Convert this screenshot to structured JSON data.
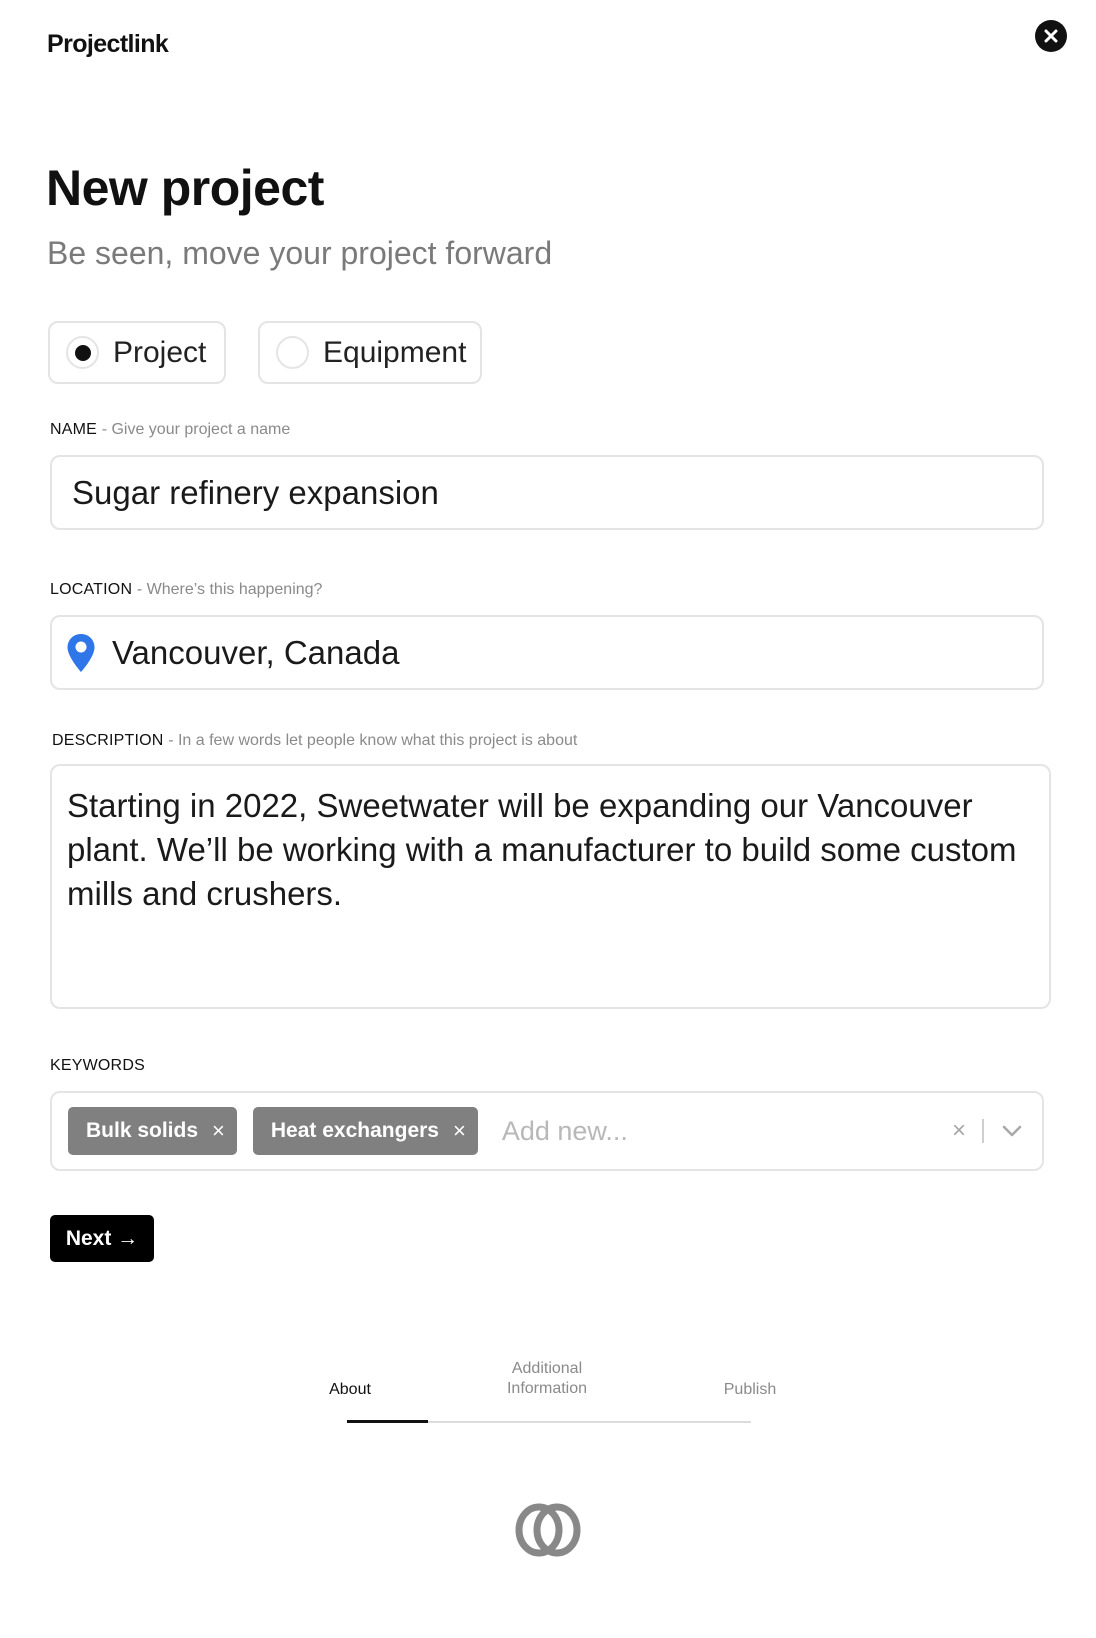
{
  "app": {
    "logo_text": "Projectlink"
  },
  "header": {
    "close_icon": "close-circle-icon"
  },
  "page": {
    "title": "New project",
    "subtitle": "Be seen, move your project forward"
  },
  "type_selector": {
    "options": [
      {
        "label": "Project",
        "selected": true
      },
      {
        "label": "Equipment",
        "selected": false
      }
    ]
  },
  "fields": {
    "name": {
      "label": "NAME",
      "hint": "- Give your project a name",
      "value": "Sugar refinery expansion"
    },
    "location": {
      "label": "LOCATION",
      "hint": "- Where’s this happening?",
      "value": "Vancouver, Canada",
      "icon": "map-pin-icon",
      "icon_color": "#2f76e8"
    },
    "description": {
      "label": "DESCRIPTION",
      "hint": "- In a few words let people know what this project is about",
      "value": "Starting in 2022, Sweetwater will be expanding our Vancouver plant. We’ll be working with a manufacturer to build some custom mills and crushers."
    },
    "keywords": {
      "label": "KEYWORDS",
      "tags": [
        "Bulk solids",
        "Heat exchangers"
      ],
      "tag_remove_glyph": "×",
      "placeholder": "Add new...",
      "clear_glyph": "×"
    }
  },
  "actions": {
    "next_label": "Next →"
  },
  "steps": {
    "items": [
      {
        "label": "About",
        "active": true
      },
      {
        "label": "Additional Information",
        "active": false
      },
      {
        "label": "Publish",
        "active": false
      }
    ],
    "progress_fraction": 0.2
  },
  "footer": {
    "logo_icon": "interlocking-rings-icon"
  },
  "colors": {
    "accent": "#000000",
    "tag_bg": "#808080",
    "pin": "#2f76e8",
    "border": "#e4e4e4"
  }
}
